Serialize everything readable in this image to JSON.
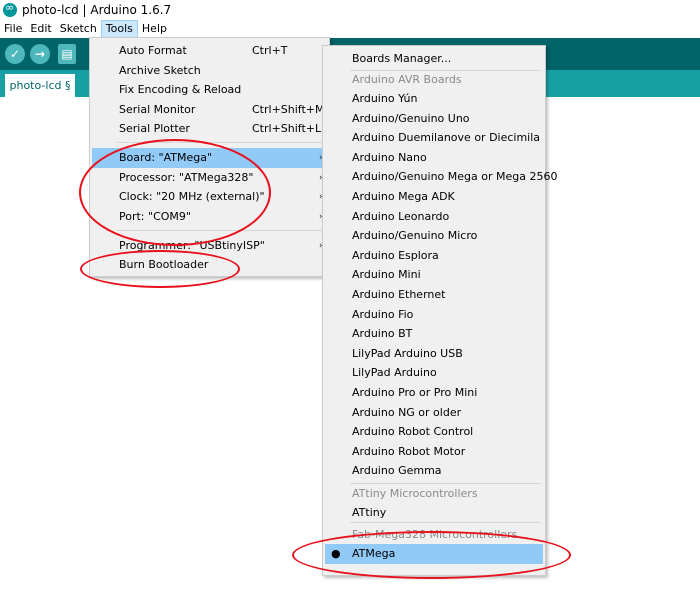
{
  "window": {
    "title": "photo-lcd | Arduino 1.6.7",
    "icon": "arduino-icon"
  },
  "menubar": {
    "items": [
      "File",
      "Edit",
      "Sketch",
      "Tools",
      "Help"
    ]
  },
  "toolbar": {
    "buttons": [
      "verify-icon",
      "upload-icon",
      "new-icon"
    ],
    "glyphs": [
      "✓",
      "→",
      "▤"
    ]
  },
  "editor": {
    "tab_label": "photo-lcd §"
  },
  "tools_menu": {
    "items": [
      {
        "label": "Auto Format",
        "shortcut": "Ctrl+T"
      },
      {
        "label": "Archive Sketch",
        "shortcut": ""
      },
      {
        "label": "Fix Encoding & Reload",
        "shortcut": ""
      },
      {
        "label": "Serial Monitor",
        "shortcut": "Ctrl+Shift+M"
      },
      {
        "label": "Serial Plotter",
        "shortcut": "Ctrl+Shift+L"
      },
      {
        "label": "Board: \"ATMega\"",
        "arrow": "›"
      },
      {
        "label": "Processor: \"ATMega328\"",
        "arrow": "›"
      },
      {
        "label": "Clock: \"20 MHz (external)\"",
        "arrow": "›"
      },
      {
        "label": "Port: \"COM9\"",
        "arrow": "›"
      },
      {
        "label": "Programmer: \"USBtinyISP\"",
        "arrow": "›"
      },
      {
        "label": "Burn Bootloader"
      }
    ]
  },
  "boards_menu": {
    "manager": "Boards Manager...",
    "avr_header": "Arduino AVR Boards",
    "avr_boards": [
      "Arduino Yún",
      "Arduino/Genuino Uno",
      "Arduino Duemilanove or Diecimila",
      "Arduino Nano",
      "Arduino/Genuino Mega or Mega 2560",
      "Arduino Mega ADK",
      "Arduino Leonardo",
      "Arduino/Genuino Micro",
      "Arduino Esplora",
      "Arduino Mini",
      "Arduino Ethernet",
      "Arduino Fio",
      "Arduino BT",
      "LilyPad Arduino USB",
      "LilyPad Arduino",
      "Arduino Pro or Pro Mini",
      "Arduino NG or older",
      "Arduino Robot Control",
      "Arduino Robot Motor",
      "Arduino Gemma"
    ],
    "attiny_header": "ATtiny Microcontrollers",
    "attiny_boards": [
      "ATtiny"
    ],
    "fab_header": "Fab-Mega328 Microcontrollers",
    "selected": "ATMega",
    "selected_bullet": "●"
  },
  "colors": {
    "toolbar": "#006468",
    "tabbar": "#17a1a5",
    "highlight": "#91c9f7",
    "annotation": "#e8101b"
  }
}
